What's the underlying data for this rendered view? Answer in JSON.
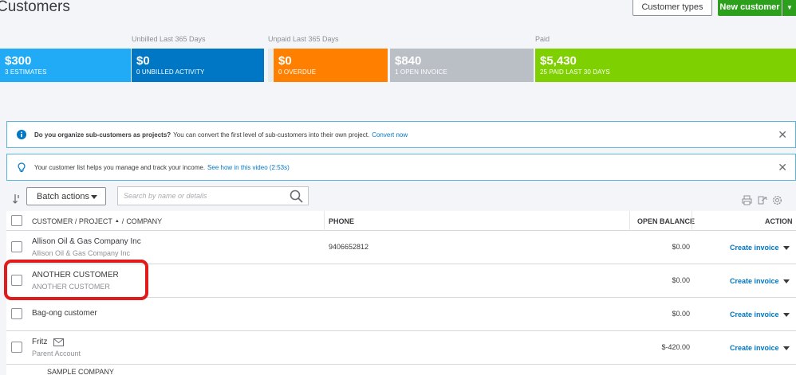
{
  "page": {
    "title": "Customers"
  },
  "header": {
    "customer_types_label": "Customer types",
    "new_customer_label": "New customer"
  },
  "money_bar": {
    "labels": {
      "unbilled": "Unbilled Last 365 Days",
      "unpaid": "Unpaid Last 365 Days",
      "paid": "Paid"
    },
    "tiles": [
      {
        "amount": "$300",
        "sub": "3 ESTIMATES",
        "color": "#21abf6"
      },
      {
        "amount": "$0",
        "sub": "0 UNBILLED ACTIVITY",
        "color": "#0077c5"
      },
      {
        "amount": "$0",
        "sub": "0 OVERDUE",
        "color": "#ff8000"
      },
      {
        "amount": "$840",
        "sub": "1 OPEN INVOICE",
        "color": "#babec5"
      },
      {
        "amount": "$5,430",
        "sub": "25 PAID LAST 30 DAYS",
        "color": "#7fd000"
      }
    ]
  },
  "banners": [
    {
      "bold": "Do you organize sub-customers as projects?",
      "text": "You can convert the first level of sub-customers into their own project.",
      "link": "Convert now",
      "icon": "info-icon"
    },
    {
      "bold": "",
      "text": "Your customer list helps you manage and track your income.",
      "link": "See how in this video (2:53s)",
      "icon": "lightbulb-icon"
    }
  ],
  "toolbar": {
    "batch_label": "Batch actions",
    "search_placeholder": "Search by name or details"
  },
  "table": {
    "headers": {
      "customer": "CUSTOMER / PROJECT",
      "company": "COMPANY",
      "sep": "/",
      "phone": "PHONE",
      "balance": "OPEN BALANCE",
      "action": "ACTION"
    },
    "rows": [
      {
        "name": "Allison Oil & Gas Company Inc",
        "company": "Allison Oil & Gas Company Inc",
        "phone": "9406652812",
        "balance": "$0.00",
        "action": "Create invoice"
      },
      {
        "name": "ANOTHER CUSTOMER",
        "company": "ANOTHER CUSTOMER",
        "phone": "",
        "balance": "$0.00",
        "action": "Create invoice"
      },
      {
        "name": "Bag-ong customer",
        "company": "",
        "phone": "",
        "balance": "$0.00",
        "action": "Create invoice"
      },
      {
        "name": "Fritz",
        "company": "Parent Account",
        "phone": "",
        "balance": "$-420.00",
        "action": "Create invoice"
      }
    ],
    "partial_row": {
      "name": "SAMPLE COMPANY"
    }
  }
}
